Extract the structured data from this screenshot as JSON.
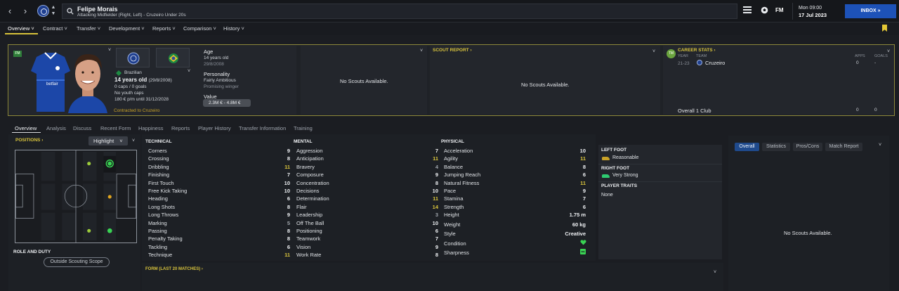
{
  "topbar": {
    "player_name": "Felipe Morais",
    "player_subtitle": "Attacking Midfielder (Right, Left) - Cruzeiro Under 20s",
    "brand": "FM",
    "time": "Mon 09:00",
    "date": "17 Jul 2023",
    "inbox_label": "INBOX"
  },
  "menu": [
    {
      "label": "Overview"
    },
    {
      "label": "Contract"
    },
    {
      "label": "Transfer"
    },
    {
      "label": "Development"
    },
    {
      "label": "Reports"
    },
    {
      "label": "Comparison"
    },
    {
      "label": "History"
    }
  ],
  "profile": {
    "fm_tag": "FM",
    "nationality": "Brazilian",
    "age_line": "14 years old",
    "dob_paren": "(29/8/2008)",
    "caps": "0 caps / 0 goals",
    "youth_caps": "No youth caps",
    "contract": "180 € p/m until 31/12/2028",
    "contracted_to": "Contracted to Cruzeiro",
    "sponsor": "betfair"
  },
  "info": {
    "age_label": "Age",
    "age_value": "14 years old",
    "dob": "29/8/2008",
    "personality_label": "Personality",
    "personality_value": "Fairly Ambitious",
    "personality_note": "Promising winger",
    "value_label": "Value",
    "value_range": "2.3M € - 4.8M €"
  },
  "scouts_left": {
    "message": "No Scouts Available."
  },
  "scout_report": {
    "title": "SCOUT REPORT",
    "message": "No Scouts Available."
  },
  "career": {
    "badge": "TM",
    "title": "CAREER STATS",
    "col_year": "YEAR",
    "col_team": "TEAM",
    "col_apps": "APPS",
    "col_goals": "GOALS",
    "row_year": "21-23",
    "row_team": "Cruzeiro",
    "row_apps": "0",
    "row_goals": "-",
    "overall_label": "Overall 1 Club",
    "overall_apps": "0",
    "overall_goals": "0"
  },
  "subtabs": [
    {
      "label": "Overview"
    },
    {
      "label": "Analysis"
    },
    {
      "label": "Discuss"
    },
    {
      "label": "Recent Form"
    },
    {
      "label": "Happiness"
    },
    {
      "label": "Reports"
    },
    {
      "label": "Player History"
    },
    {
      "label": "Transfer Information"
    },
    {
      "label": "Training"
    }
  ],
  "positions": {
    "title": "POSITIONS",
    "dropdown": "Highlight",
    "role_title": "ROLE AND DUTY",
    "scope_button": "Outside Scouting Scope"
  },
  "attributes": {
    "technical_title": "TECHNICAL",
    "mental_title": "MENTAL",
    "physical_title": "PHYSICAL",
    "technical": [
      {
        "name": "Corners",
        "value": "9",
        "tone": "white"
      },
      {
        "name": "Crossing",
        "value": "8",
        "tone": "white"
      },
      {
        "name": "Dribbling",
        "value": "11",
        "tone": "yellow"
      },
      {
        "name": "Finishing",
        "value": "7",
        "tone": "white"
      },
      {
        "name": "First Touch",
        "value": "10",
        "tone": "white"
      },
      {
        "name": "Free Kick Taking",
        "value": "10",
        "tone": "white"
      },
      {
        "name": "Heading",
        "value": "6",
        "tone": "white"
      },
      {
        "name": "Long Shots",
        "value": "8",
        "tone": "white"
      },
      {
        "name": "Long Throws",
        "value": "9",
        "tone": "white"
      },
      {
        "name": "Marking",
        "value": "5",
        "tone": "grey"
      },
      {
        "name": "Passing",
        "value": "8",
        "tone": "white"
      },
      {
        "name": "Penalty Taking",
        "value": "8",
        "tone": "white"
      },
      {
        "name": "Tackling",
        "value": "6",
        "tone": "white"
      },
      {
        "name": "Technique",
        "value": "11",
        "tone": "yellow"
      }
    ],
    "mental": [
      {
        "name": "Aggression",
        "value": "7",
        "tone": "white"
      },
      {
        "name": "Anticipation",
        "value": "11",
        "tone": "yellow"
      },
      {
        "name": "Bravery",
        "value": "4",
        "tone": "grey"
      },
      {
        "name": "Composure",
        "value": "9",
        "tone": "white"
      },
      {
        "name": "Concentration",
        "value": "8",
        "tone": "white"
      },
      {
        "name": "Decisions",
        "value": "10",
        "tone": "white"
      },
      {
        "name": "Determination",
        "value": "11",
        "tone": "yellow"
      },
      {
        "name": "Flair",
        "value": "14",
        "tone": "yellow"
      },
      {
        "name": "Leadership",
        "value": "3",
        "tone": "grey"
      },
      {
        "name": "Off The Ball",
        "value": "10",
        "tone": "white"
      },
      {
        "name": "Positioning",
        "value": "6",
        "tone": "white"
      },
      {
        "name": "Teamwork",
        "value": "7",
        "tone": "white"
      },
      {
        "name": "Vision",
        "value": "9",
        "tone": "white"
      },
      {
        "name": "Work Rate",
        "value": "8",
        "tone": "white"
      }
    ],
    "physical": [
      {
        "name": "Acceleration",
        "value": "10",
        "tone": "white"
      },
      {
        "name": "Agility",
        "value": "11",
        "tone": "yellow"
      },
      {
        "name": "Balance",
        "value": "8",
        "tone": "white"
      },
      {
        "name": "Jumping Reach",
        "value": "6",
        "tone": "white"
      },
      {
        "name": "Natural Fitness",
        "value": "11",
        "tone": "yellow"
      },
      {
        "name": "Pace",
        "value": "9",
        "tone": "white"
      },
      {
        "name": "Stamina",
        "value": "7",
        "tone": "white"
      },
      {
        "name": "Strength",
        "value": "6",
        "tone": "white"
      }
    ],
    "height_label": "Height",
    "height_value": "1.75 m",
    "weight_label": "Weight",
    "weight_value": "60 kg",
    "style_label": "Style",
    "style_value": "Creative",
    "condition_label": "Condition",
    "sharpness_label": "Sharpness"
  },
  "feet": {
    "left_title": "LEFT FOOT",
    "left_value": "Reasonable",
    "right_title": "RIGHT FOOT",
    "right_value": "Very Strong",
    "traits_title": "PLAYER TRAITS",
    "traits_value": "None",
    "left_color": "#c9a227",
    "right_color": "#2ecc71"
  },
  "form": {
    "title": "FORM (LAST 20 MATCHES)"
  },
  "overall_panel": {
    "tabs": [
      "Overall",
      "Statistics",
      "Pros/Cons",
      "Match Report"
    ],
    "message": "No Scouts Available."
  },
  "colors": {
    "accent": "#d7c23a",
    "brand_blue": "#1d52b8"
  }
}
